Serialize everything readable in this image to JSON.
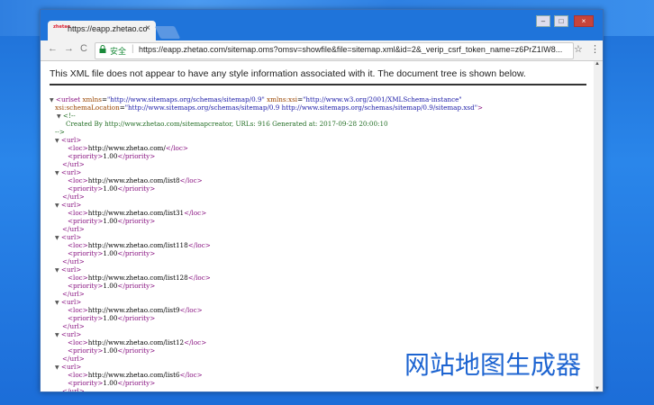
{
  "browser": {
    "tab_title": "https://eapp.zhetao.co",
    "tab_favicon": "zhetao",
    "tab_close": "×",
    "secure_label": "安全",
    "url": "https://eapp.zhetao.com/sitemap.oms?omsv=showfile&file=sitemap.xml&id=2&_verip_csrf_token_name=z6PrZ1IW8...",
    "icons": {
      "back": "←",
      "forward": "→",
      "reload": "C",
      "lock": "🔒",
      "star": "☆",
      "menu": "⋮"
    },
    "window_controls": {
      "minimize": "–",
      "maximize": "□",
      "close": "×"
    }
  },
  "page": {
    "notice": "This XML file does not appear to have any style information associated with it. The document tree is shown below."
  },
  "xml": {
    "urlset_open_1": "<urlset",
    "xmlns_attr": "xmlns",
    "xmlns_val": "\"http://www.sitemaps.org/schemas/sitemap/0.9\"",
    "xsi_attr": "xmlns:xsi",
    "xsi_val": "\"http://www.w3.org/2001/XMLSchema-instance\"",
    "schema_attr": "xsi:schemaLocation",
    "schema_val": "\"http://www.sitemaps.org/schemas/sitemap/0.9 http://www.sitemaps.org/schemas/sitemap/0.9/sitemap.xsd\"",
    "close_bracket": ">",
    "comment_open": "<!--",
    "comment_text": "Created By http://www.zhetao.com/sitemapcreator, URLs: 916 Generated at: 2017-09-28 20:00:10",
    "comment_close": "-->",
    "entries": [
      {
        "loc": "http://www.zhetao.com/",
        "priority": "1.00"
      },
      {
        "loc": "http://www.zhetao.com/list8",
        "priority": "1.00"
      },
      {
        "loc": "http://www.zhetao.com/list31",
        "priority": "1.00"
      },
      {
        "loc": "http://www.zhetao.com/list118",
        "priority": "1.00"
      },
      {
        "loc": "http://www.zhetao.com/list128",
        "priority": "1.00"
      },
      {
        "loc": "http://www.zhetao.com/list9",
        "priority": "1.00"
      },
      {
        "loc": "http://www.zhetao.com/list12",
        "priority": "1.00"
      },
      {
        "loc": "http://www.zhetao.com/list6",
        "priority": "1.00"
      }
    ],
    "url_open": "<url>",
    "url_close": "</url>",
    "loc_open": "<loc>",
    "loc_close": "</loc>",
    "priority_open": "<priority>",
    "priority_close": "</priority>",
    "triangle": "▼"
  },
  "overlay": {
    "caption": "网站地图生成器"
  }
}
